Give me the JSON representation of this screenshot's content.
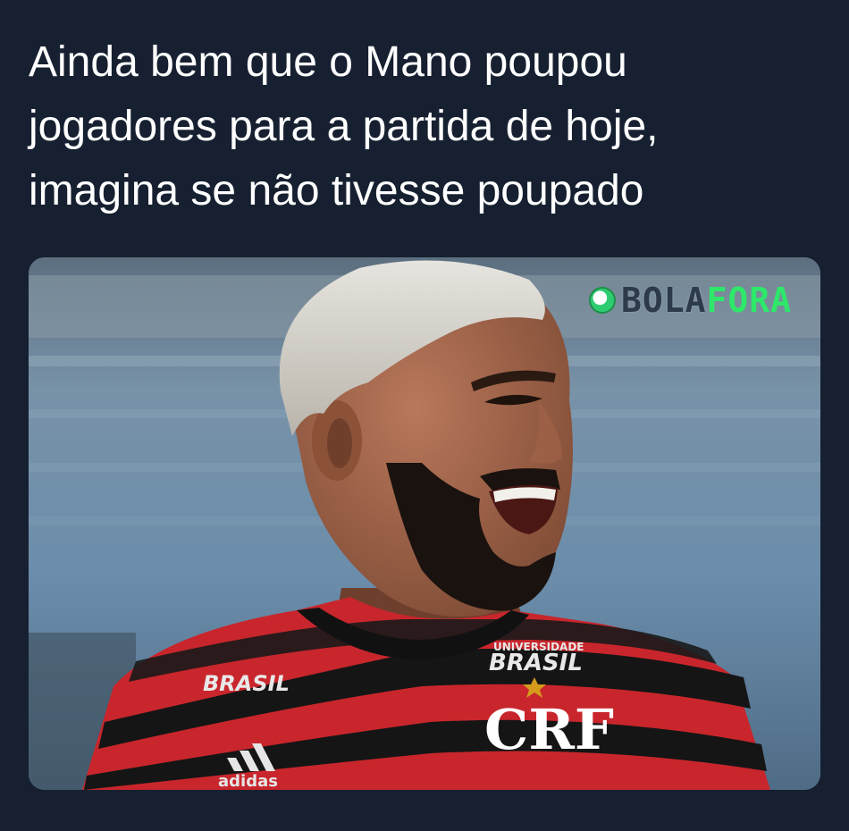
{
  "post": {
    "lines": [
      "Ainda bem que o Mano poupou",
      "jogadores para a partida de hoje,",
      "imagina se não tivesse poupado"
    ]
  },
  "media": {
    "watermark_part1": "BOLA",
    "watermark_part2": "FORA",
    "watermark_icon": "soccer-ball-icon",
    "jersey_sponsor_left": "BRASIL",
    "jersey_sponsor_right_top": "UNIVERSIDADE",
    "jersey_sponsor_right": "BRASIL",
    "jersey_crest": "CRF",
    "jersey_brand": "adidas",
    "colors": {
      "background": "#162030",
      "watermark_green": "#2ee86a",
      "jersey_red": "#c8262c",
      "jersey_black": "#151515"
    }
  }
}
